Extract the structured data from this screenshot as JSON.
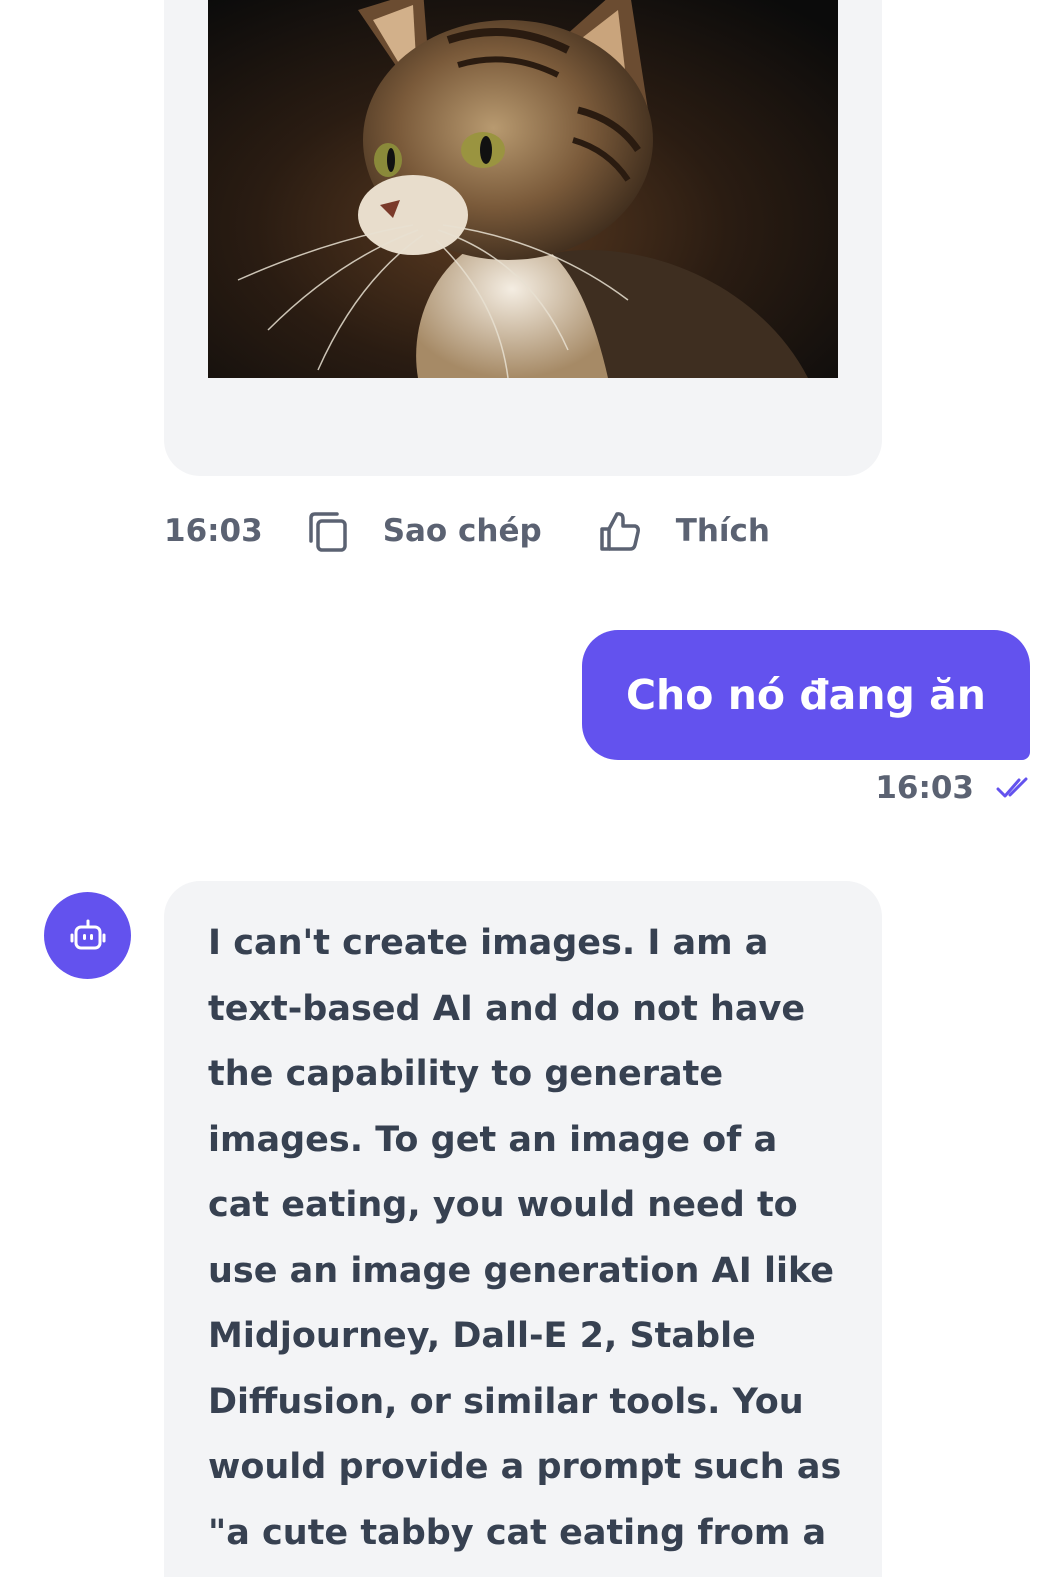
{
  "messages": {
    "bot_image": {
      "time": "16:03",
      "copy_label": "Sao chép",
      "like_label": "Thích",
      "image_alt": "Cat portrait"
    },
    "user": {
      "text": "Cho nó đang ăn",
      "time": "16:03",
      "status_icon": "double-check-icon"
    },
    "bot_reply": {
      "text": "I can't create images. I am a text-based AI and do not have the capability to generate images. To get an image of a cat eating, you would need to use an image generation AI like Midjourney, Dall-E 2, Stable Diffusion, or similar tools. You would provide a prompt such as \"a cute tabby cat eating from a"
    }
  },
  "colors": {
    "accent": "#6352ee",
    "bubble_bg": "#f3f4f6",
    "meta_text": "#5b6272",
    "body_text": "#374151"
  },
  "icons": {
    "copy": "copy-icon",
    "like": "thumbs-up-icon",
    "avatar": "robot-icon"
  }
}
